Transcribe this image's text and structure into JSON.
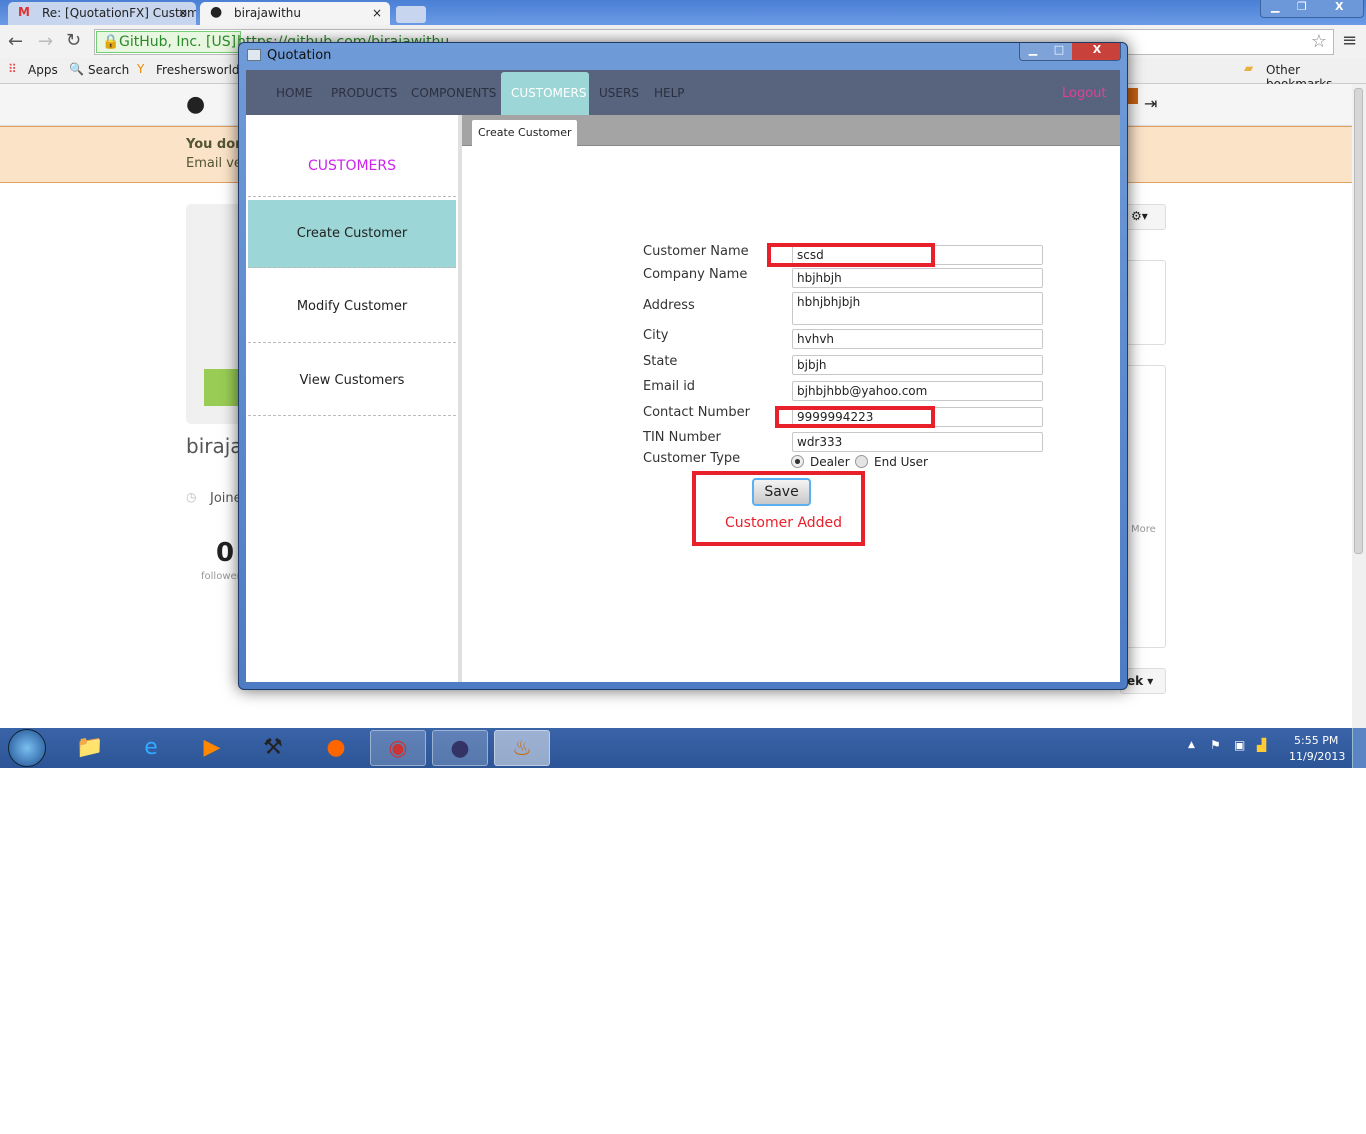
{
  "browser": {
    "tabs": [
      {
        "title": "Re: [QuotationFX] Custom",
        "icon": "gmail-icon"
      },
      {
        "title": "birajawithu",
        "icon": "github-icon"
      }
    ],
    "security_label": "GitHub, Inc. [US]",
    "url": "https://github.com/birajawithu",
    "bookmarks": [
      "Apps",
      "Search",
      "Freshersworld.c"
    ],
    "other_bookmarks": "Other bookmarks"
  },
  "github": {
    "banner_line1": "You don",
    "banner_line2": "Email ver",
    "username": "birajaw",
    "joined": "Joine",
    "followers_count": "0",
    "followers_label": "follower",
    "more": "More",
    "week": "ek"
  },
  "window": {
    "title": "Quotation",
    "nav": [
      "HOME",
      "PRODUCTS",
      "COMPONENTS",
      "CUSTOMERS",
      "USERS",
      "HELP"
    ],
    "active_nav": "CUSTOMERS",
    "logout": "Logout",
    "sidebar": {
      "title": "CUSTOMERS",
      "items": [
        "Create Customer",
        "Modify Customer",
        "View Customers"
      ],
      "active": "Create Customer"
    },
    "tab": "Create Customer",
    "form": {
      "fields": [
        {
          "label": "Customer Name",
          "value": "scsd"
        },
        {
          "label": "Company Name",
          "value": "hbjhbjh"
        },
        {
          "label": "Address",
          "value": "hbhjbhjbjh"
        },
        {
          "label": "City",
          "value": "hvhvh"
        },
        {
          "label": "State",
          "value": "bjbjh"
        },
        {
          "label": "Email id",
          "value": "bjhbjhbb@yahoo.com"
        },
        {
          "label": "Contact Number",
          "value": "9999994223"
        },
        {
          "label": "TIN Number",
          "value": "wdr333"
        }
      ],
      "customer_type_label": "Customer Type",
      "options": [
        "Dealer",
        "End User"
      ],
      "selected": "Dealer",
      "save": "Save",
      "status": "Customer Added"
    }
  },
  "taskbar": {
    "time": "5:55 PM",
    "date": "11/9/2013"
  },
  "colors": {
    "nav": "#58637e",
    "active": "#9dd6d6",
    "logout": "#e0409a",
    "sidebar_title": "#cc22ee",
    "status": "#e8202a"
  }
}
